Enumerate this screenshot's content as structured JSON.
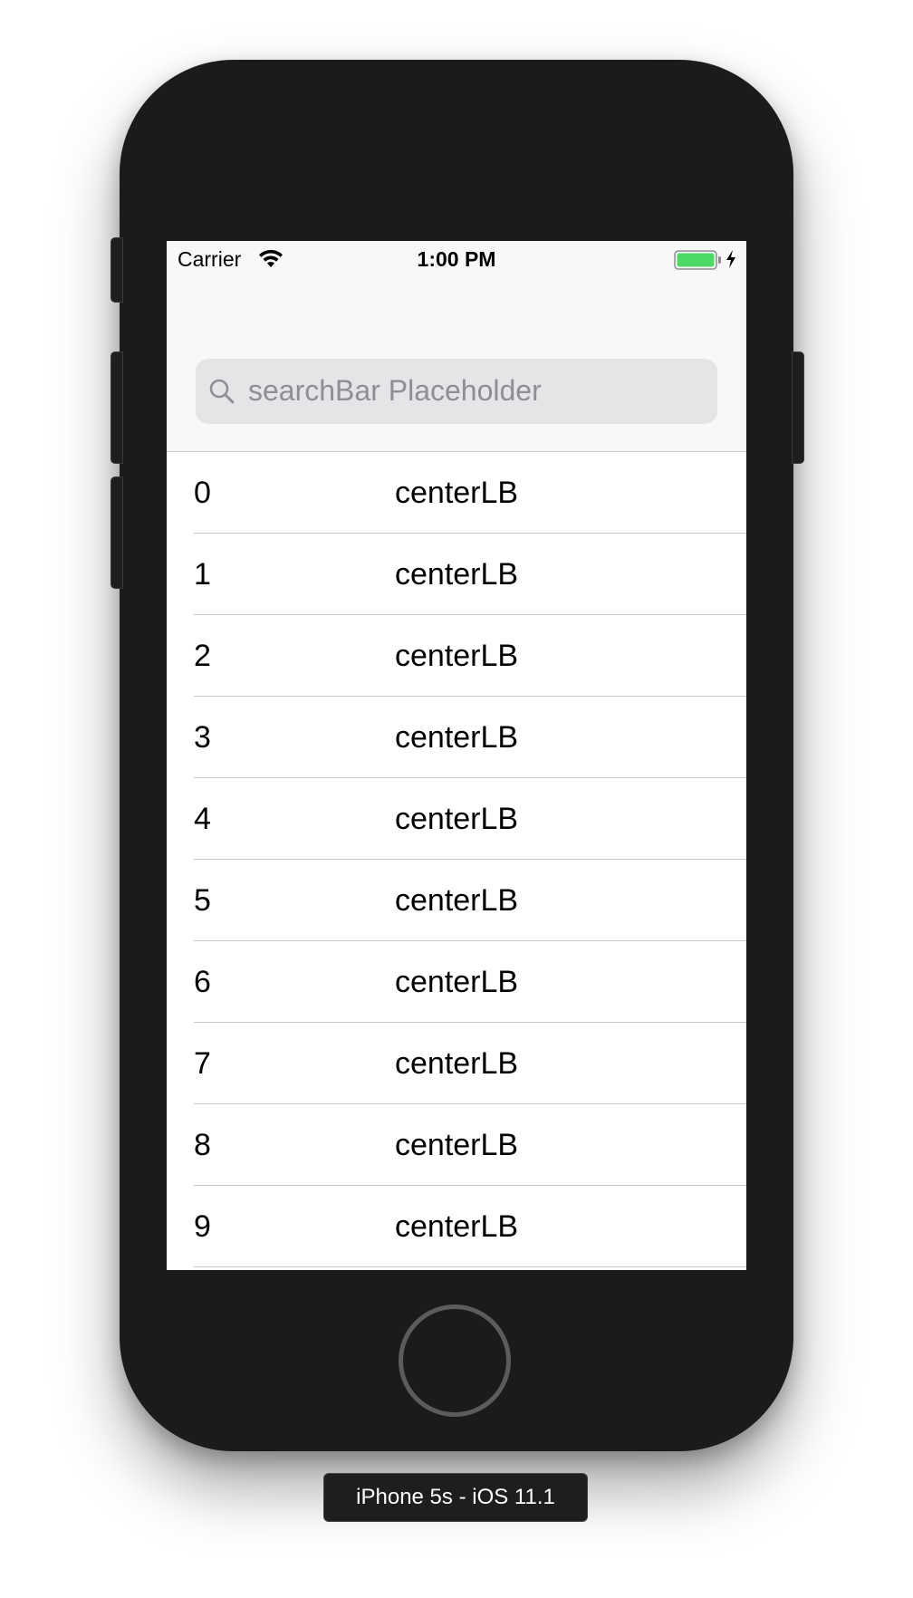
{
  "device": {
    "label": "iPhone 5s - iOS 11.1"
  },
  "status_bar": {
    "carrier": "Carrier",
    "time": "1:00 PM",
    "battery_color": "#4cd964",
    "icons": [
      "wifi-icon",
      "battery-icon",
      "charging-icon"
    ]
  },
  "search": {
    "placeholder": "searchBar Placeholder",
    "icon": "search-icon"
  },
  "table": {
    "rows": [
      {
        "index": "0",
        "center": "centerLB"
      },
      {
        "index": "1",
        "center": "centerLB"
      },
      {
        "index": "2",
        "center": "centerLB"
      },
      {
        "index": "3",
        "center": "centerLB"
      },
      {
        "index": "4",
        "center": "centerLB"
      },
      {
        "index": "5",
        "center": "centerLB"
      },
      {
        "index": "6",
        "center": "centerLB"
      },
      {
        "index": "7",
        "center": "centerLB"
      },
      {
        "index": "8",
        "center": "centerLB"
      },
      {
        "index": "9",
        "center": "centerLB"
      }
    ]
  }
}
